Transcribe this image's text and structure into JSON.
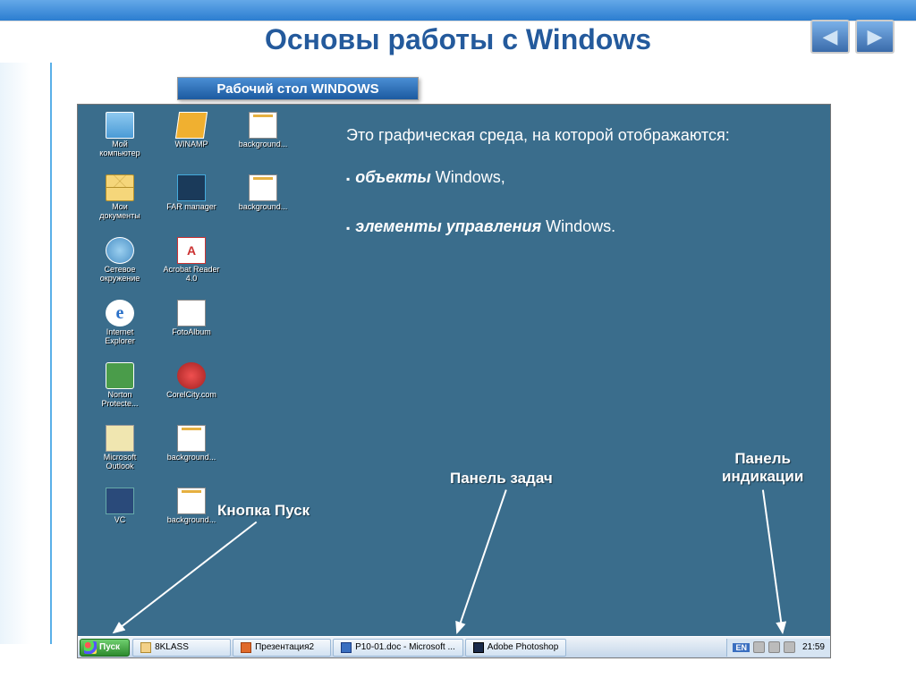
{
  "slide": {
    "title": "Основы работы с Windows",
    "subtitle": "Рабочий стол WINDOWS"
  },
  "nav": {
    "prev": "◀",
    "next": "▶"
  },
  "desktop_icons": [
    {
      "label": "Мой\nкомпьютер",
      "glyph": "gl-computer"
    },
    {
      "label": "WINAMP",
      "glyph": "gl-winamp"
    },
    {
      "label": "background...",
      "glyph": "gl-file"
    },
    {
      "label": "Мои\nдокументы",
      "glyph": "gl-envelope"
    },
    {
      "label": "FAR manager",
      "glyph": "gl-far"
    },
    {
      "label": "background...",
      "glyph": "gl-file"
    },
    {
      "label": "Сетевое\nокружение",
      "glyph": "gl-network"
    },
    {
      "label": "Acrobat Reader\n4.0",
      "glyph": "gl-acrobat"
    },
    {
      "label": "",
      "glyph": ""
    },
    {
      "label": "Internet\nExplorer",
      "glyph": "gl-ie"
    },
    {
      "label": "FotoAlbum",
      "glyph": "gl-foto"
    },
    {
      "label": "",
      "glyph": ""
    },
    {
      "label": "Norton\nProtecte...",
      "glyph": "gl-norton"
    },
    {
      "label": "CorelCity.com",
      "glyph": "gl-corel"
    },
    {
      "label": "",
      "glyph": ""
    },
    {
      "label": "Microsoft\nOutlook",
      "glyph": "gl-outlook"
    },
    {
      "label": "background...",
      "glyph": "gl-file"
    },
    {
      "label": "",
      "glyph": ""
    },
    {
      "label": "VC",
      "glyph": "gl-vc"
    },
    {
      "label": "background...",
      "glyph": "gl-file"
    }
  ],
  "description": {
    "intro": "Это графическая среда, на которой отображаются:",
    "items": [
      {
        "bold": "объекты",
        "rest": " Windows,"
      },
      {
        "bold": "элементы управления",
        "rest": " Windows."
      }
    ]
  },
  "callouts": {
    "start": "Кнопка Пуск",
    "taskbar": "Панель задач",
    "tray": "Панель\nиндикации"
  },
  "taskbar": {
    "start": "Пуск",
    "items": [
      {
        "icon": "ti-folder",
        "label": "8KLASS"
      },
      {
        "icon": "ti-ppt",
        "label": "Презентация2"
      },
      {
        "icon": "ti-word",
        "label": "P10-01.doc - Microsoft ..."
      },
      {
        "icon": "ti-ps",
        "label": "Adobe Photoshop"
      }
    ],
    "lang": "EN",
    "clock": "21:59"
  }
}
